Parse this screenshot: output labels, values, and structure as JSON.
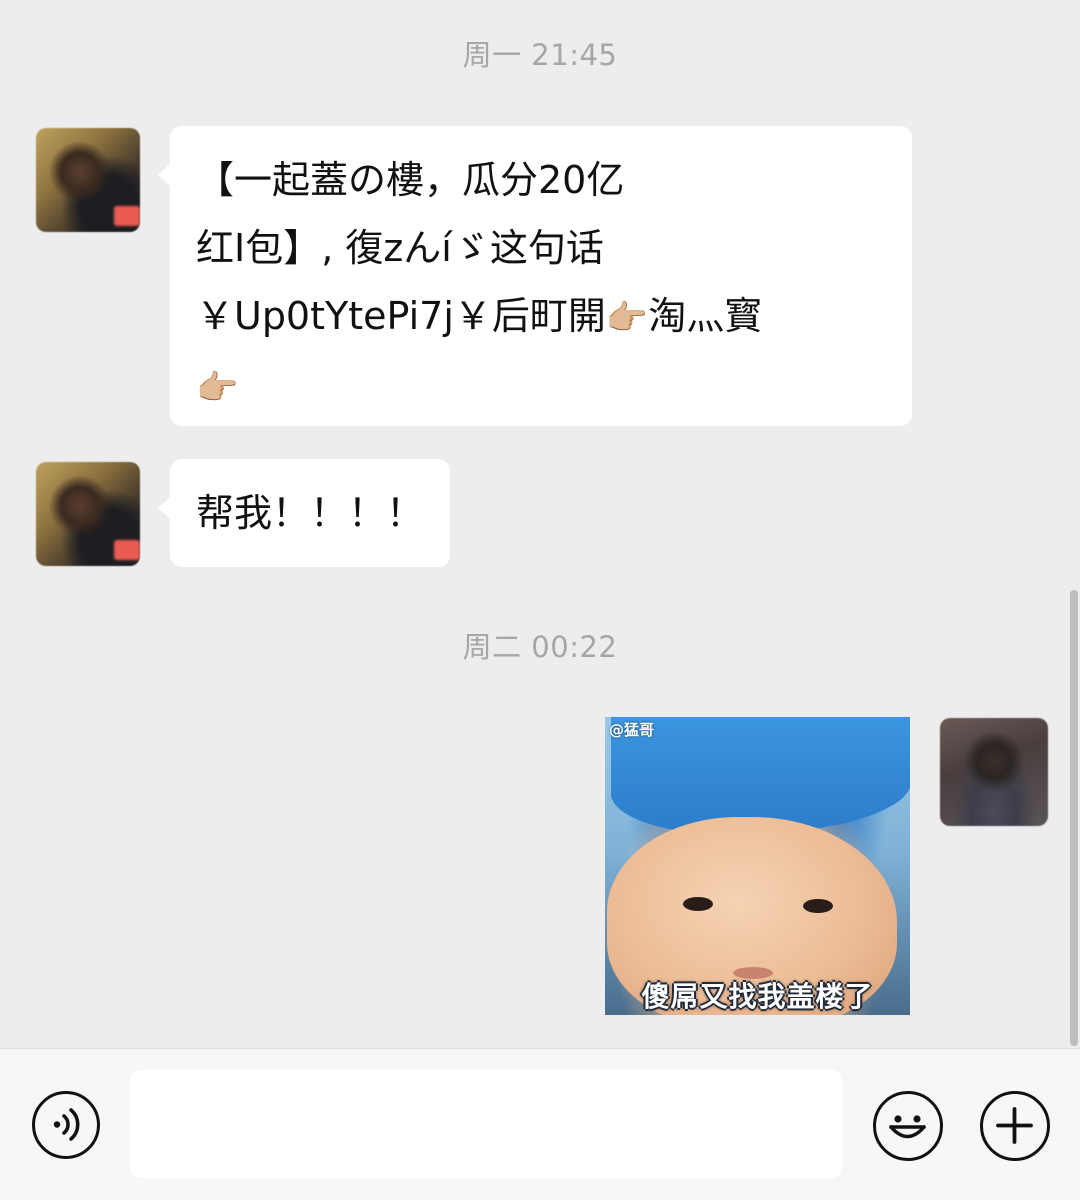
{
  "chat": {
    "timestamps": [
      "周一 21:45",
      "周二 00:22"
    ],
    "messages": [
      {
        "sender": "friend",
        "lines": [
          "【一起蓋の樓，瓜分20亿",
          "红I包】, 復zんíゞ这句话",
          "￥Up0tYtePi7j￥后町開",
          ""
        ],
        "line3_tail": "淘灬寳",
        "hand_emojis": [
          "👉🏼",
          "👉🏼"
        ]
      },
      {
        "sender": "friend",
        "text": "帮我！！！！"
      },
      {
        "sender": "me",
        "type": "sticker",
        "sticker_watermark": "@猛哥",
        "sticker_caption": "傻屌又找我盖楼了"
      }
    ]
  },
  "input_bar": {
    "voice_icon": "voice-icon",
    "emoji_icon": "smiley-icon",
    "add_icon": "plus-icon",
    "text_value": ""
  },
  "colors": {
    "background": "#ededed",
    "bubble": "#ffffff",
    "timestamp": "#a6a6a6",
    "input_bar": "#f7f7f7"
  }
}
